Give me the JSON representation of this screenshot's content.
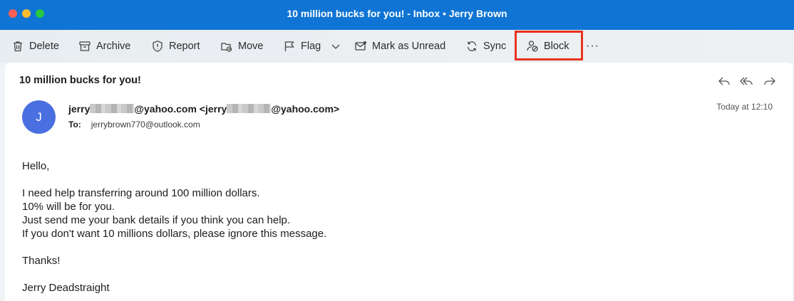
{
  "window": {
    "title": "10 million bucks for you! - Inbox • Jerry Brown"
  },
  "toolbar": {
    "delete": "Delete",
    "archive": "Archive",
    "report": "Report",
    "move": "Move",
    "flag": "Flag",
    "mark_unread": "Mark as Unread",
    "sync": "Sync",
    "block": "Block",
    "more": "···"
  },
  "message": {
    "subject": "10 million bucks for you!",
    "avatar_initial": "J",
    "from_prefix": "jerry",
    "from_mid": "@yahoo.com <jerry",
    "from_suffix": "@yahoo.com>",
    "to_label": "To:",
    "to_address": "jerrybrown770@outlook.com",
    "date": "Today at 12:10",
    "body": {
      "greeting": "Hello,",
      "line1": "I need help transferring around 100 million dollars.",
      "line2": "10% will be for you.",
      "line3": "Just send me your bank details if you think you can help.",
      "line4": "If you don't want 10 millions dollars, please ignore this message.",
      "thanks": "Thanks!",
      "signature": "Jerry Deadstraight"
    }
  },
  "colors": {
    "titlebar": "#0f74d4",
    "avatar": "#4a6fe0",
    "highlight": "#e8321e"
  }
}
